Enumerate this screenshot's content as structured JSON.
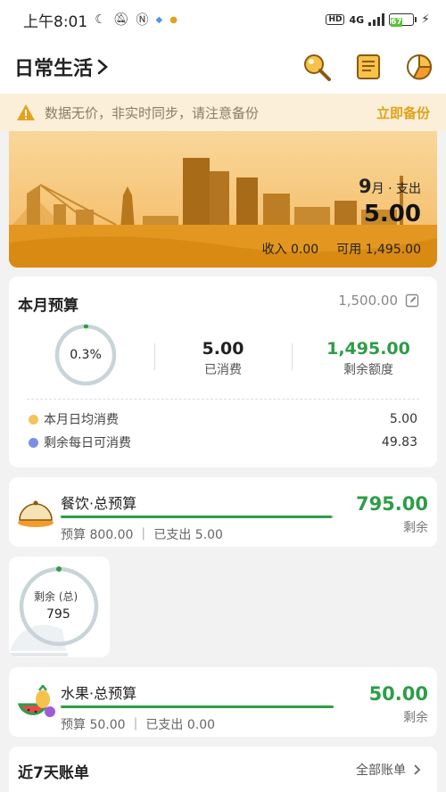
{
  "status_bar": {
    "time": "上午8:01",
    "network": "4G",
    "hd": "HD",
    "battery": "67",
    "battery_level": 0.67
  },
  "header": {
    "title": "日常生活",
    "icons": [
      "search-icon",
      "scroll-icon",
      "pie-chart-icon"
    ]
  },
  "notice": {
    "message": "数据无价，非实时同步，请注意备份",
    "action": "立即备份"
  },
  "banner": {
    "month_num": "9",
    "month_text": "月 · 支出",
    "expense": "5.00",
    "income": "收入 0.00",
    "available": "可用 1,495.00"
  },
  "budget": {
    "title": "本月预算",
    "total": "1,500.00",
    "percent_used": "0.3%",
    "percent_value": 0.003,
    "spent_value": "5.00",
    "spent_label": "已消费",
    "remaining_value": "1,495.00",
    "remaining_label": "剩余额度",
    "daily_avg_label": "本月日均消费",
    "daily_avg_value": "5.00",
    "daily_left_label": "剩余每日可消费",
    "daily_left_value": "49.83",
    "colors": {
      "green": "#2e9d48",
      "yellow_dot": "#f2c45a",
      "blue_dot": "#7b8fe6"
    }
  },
  "categories": [
    {
      "name": "餐饮·总预算",
      "sub": "预算 800.00 ｜ 已支出 5.00",
      "remaining": "795.00",
      "remaining_label": "剩余",
      "icon": "food-dome-icon",
      "progress": 0.994
    },
    {
      "name": "水果·总预算",
      "sub": "预算 50.00 ｜ 已支出 0.00",
      "remaining": "50.00",
      "remaining_label": "剩余",
      "icon": "fruit-icon",
      "progress": 1.0
    }
  ],
  "float_card": {
    "label": "剩余 (总)",
    "value": "795"
  },
  "recent": {
    "title": "近7天账单",
    "all": "全部账单"
  }
}
